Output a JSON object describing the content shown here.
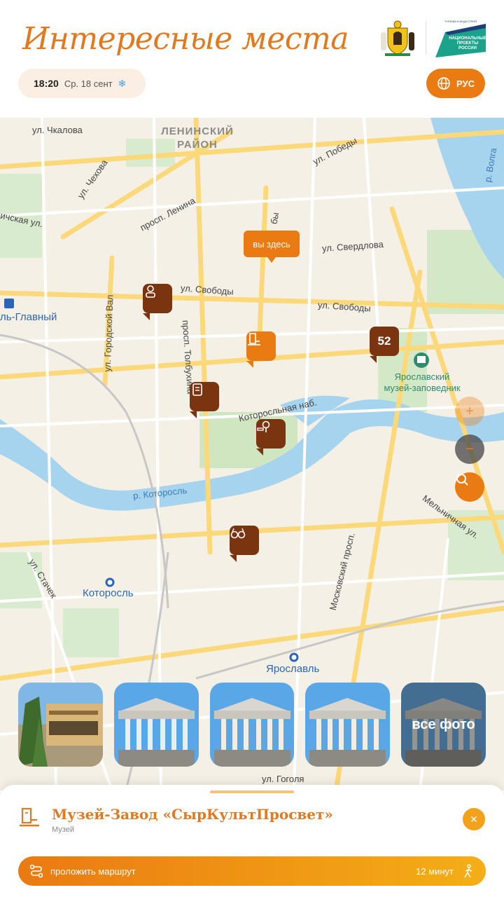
{
  "header": {
    "title": "Интересные места",
    "time": "18:20",
    "date": "Ср. 18 сент",
    "weather_icon": "snowflake-icon",
    "lang_label": "РУС",
    "np_logo_text": "НАЦИОНАЛЬНЫЕ ПРОЕКТЫ РОССИИ"
  },
  "map": {
    "labels": {
      "chkalova": "ул. Чкалова",
      "district": "ЛЕНИНСКИЙ РАЙОН",
      "pobedy": "ул. Победы",
      "volga": "р. Волга",
      "chekhova": "ул. Чехова",
      "lenina": "просп. Ленина",
      "ichskaya": "ичская ул.",
      "pervomayskaya": "бы",
      "sverdlova": "ул. Свердлова",
      "svobody1": "ул. Свободы",
      "svobody2": "ул. Свободы",
      "gorodskoy_val": "ул. Городской Вал",
      "tolbukhina": "просп. Толбухина",
      "kotoroslnaya": "Которосльная наб.",
      "kotorosl_river": "р. Которосль",
      "moskovsky": "Московский просп.",
      "melnichnaya": "Мельничная ул.",
      "stachek": "ул. Стачек",
      "gogolya": "ул. Гоголя",
      "museum": "Ярославский музей-заповедник"
    },
    "metro": {
      "glavny": "ль-Главный",
      "kotorosl": "Которосль",
      "yaroslavl": "Ярославль"
    },
    "you_here": "вы здесь",
    "cluster_count": "52",
    "pins": [
      {
        "icon": "person-icon",
        "style": "brown"
      },
      {
        "icon": "museum-icon",
        "style": "orange"
      },
      {
        "icon": "info-board-icon",
        "style": "brown"
      },
      {
        "icon": "tree-bench-icon",
        "style": "brown"
      },
      {
        "icon": "glasses-icon",
        "style": "brown"
      }
    ],
    "controls": {
      "zoom_in": "+",
      "zoom_out": "−",
      "search_icon": "search-icon"
    }
  },
  "photos": {
    "more_label": "все фото"
  },
  "place": {
    "name": "Музей-Завод «СырКультПросвет»",
    "type": "Музей",
    "route_label": "проложить маршрут",
    "walk_time": "12 минут"
  },
  "colors": {
    "accent": "#ea7a12",
    "accent_light": "#f4ae17",
    "pin_brown": "#7a3410",
    "title": "#e0791f"
  }
}
